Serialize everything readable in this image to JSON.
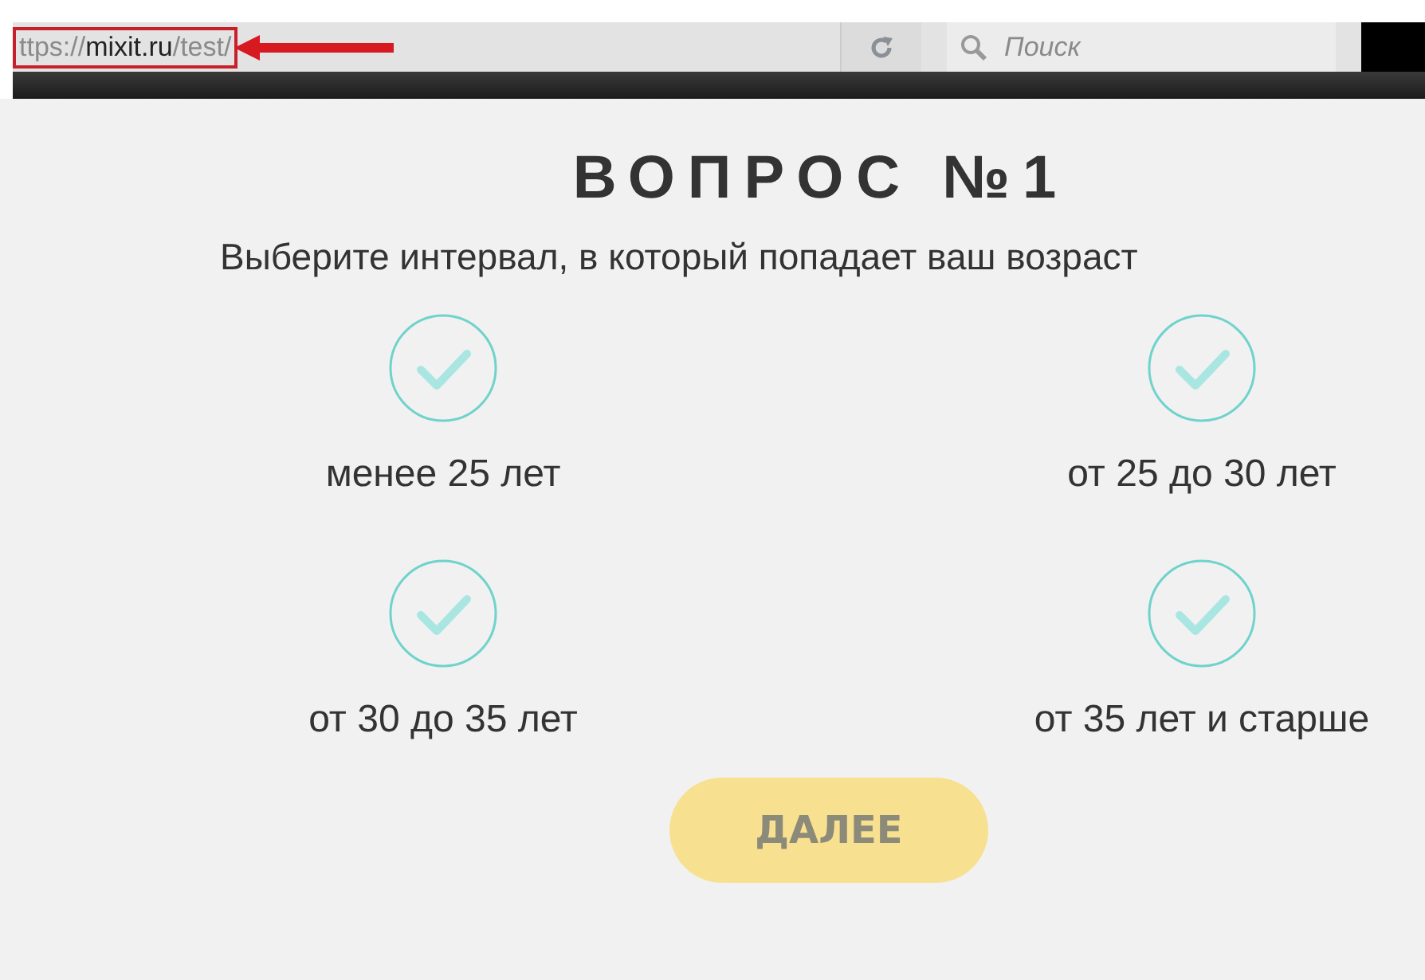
{
  "browser": {
    "url": {
      "scheme": "ttps://",
      "domain": "mixit.ru",
      "path": "/test/"
    },
    "search": {
      "placeholder": "Поиск"
    }
  },
  "title": "ВОПРОС №1",
  "question": "Выберите интервал, в который попадает ваш возраст",
  "options": [
    {
      "label": "менее 25 лет",
      "selected": false
    },
    {
      "label": "от 25 до 30 лет",
      "selected": false
    },
    {
      "label": "от 30 до 35 лет",
      "selected": false
    },
    {
      "label": "от 35 лет и старше",
      "selected": false
    }
  ],
  "next_button": {
    "label": "ДАЛЕЕ",
    "disabled": true
  }
}
